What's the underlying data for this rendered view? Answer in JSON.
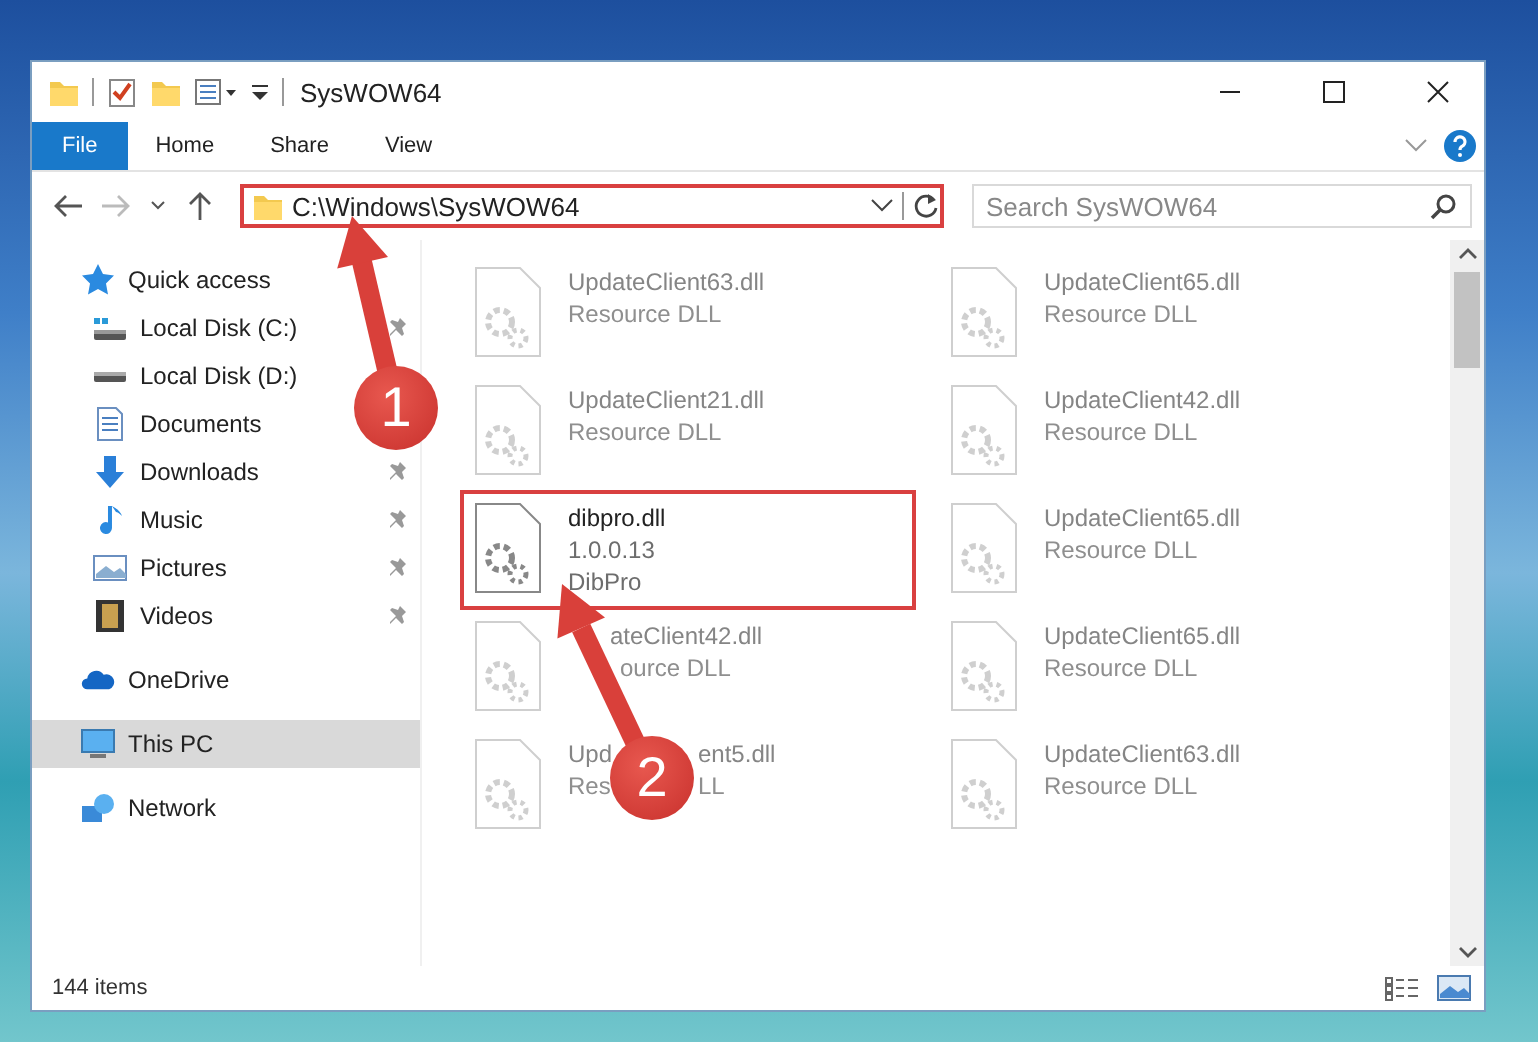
{
  "window": {
    "title": "SysWOW64"
  },
  "ribbon_tabs": [
    {
      "label": "File",
      "kind": "file"
    },
    {
      "label": "Home",
      "kind": "tab"
    },
    {
      "label": "Share",
      "kind": "tab"
    },
    {
      "label": "View",
      "kind": "tab"
    }
  ],
  "address": {
    "path": "C:\\Windows\\SysWOW64",
    "highlighted": true
  },
  "search": {
    "placeholder": "Search SysWOW64"
  },
  "nav": [
    {
      "label": "Quick access",
      "kind": "quick",
      "selected": false,
      "children": [
        {
          "label": "Local Disk (C:)",
          "kind": "system-drive",
          "pinned": true,
          "selected": false
        },
        {
          "label": "Local Disk (D:)",
          "kind": "drive",
          "selected": false
        },
        {
          "label": "Documents",
          "kind": "documents",
          "selected": false
        },
        {
          "label": "Downloads",
          "kind": "downloads",
          "pinned": true,
          "selected": false
        },
        {
          "label": "Music",
          "kind": "music",
          "pinned": true,
          "selected": false
        },
        {
          "label": "Pictures",
          "kind": "pictures",
          "pinned": true,
          "selected": false
        },
        {
          "label": "Videos",
          "kind": "videos",
          "pinned": true,
          "selected": false
        }
      ]
    },
    {
      "label": "OneDrive",
      "kind": "cloud",
      "selected": false
    },
    {
      "label": "This PC",
      "kind": "pc",
      "selected": true
    },
    {
      "label": "Network",
      "kind": "network",
      "selected": false
    }
  ],
  "files": [
    {
      "lines": [
        "UpdateClient63.dll",
        "Resource DLL"
      ],
      "highlighted": false
    },
    {
      "lines": [
        "UpdateClient65.dll",
        "Resource DLL"
      ],
      "highlighted": false
    },
    {
      "lines": [
        "UpdateClient21.dll",
        "Resource DLL"
      ],
      "highlighted": false
    },
    {
      "lines": [
        "UpdateClient42.dll",
        "Resource DLL"
      ],
      "highlighted": false
    },
    {
      "lines": [
        "dibpro.dll",
        "1.0.0.13",
        "DibPro"
      ],
      "highlighted": true
    },
    {
      "lines": [
        "UpdateClient65.dll",
        "Resource DLL"
      ],
      "highlighted": false
    },
    {
      "lines": [
        [
          "ateClient42.dll"
        ],
        [
          "ource DLL"
        ]
      ],
      "highlighted": false
    },
    {
      "lines": [
        "UpdateClient65.dll",
        "Resource DLL"
      ],
      "highlighted": false
    },
    {
      "lines": [
        [
          "Upd",
          "ent5.dll"
        ],
        [
          "Res",
          "LL"
        ]
      ],
      "highlighted": false
    },
    {
      "lines": [
        "UpdateClient63.dll",
        "Resource DLL"
      ],
      "highlighted": false
    }
  ],
  "status_bar": {
    "count": "144 items"
  },
  "annotations": [
    {
      "label": "1"
    },
    {
      "label": "2"
    }
  ]
}
